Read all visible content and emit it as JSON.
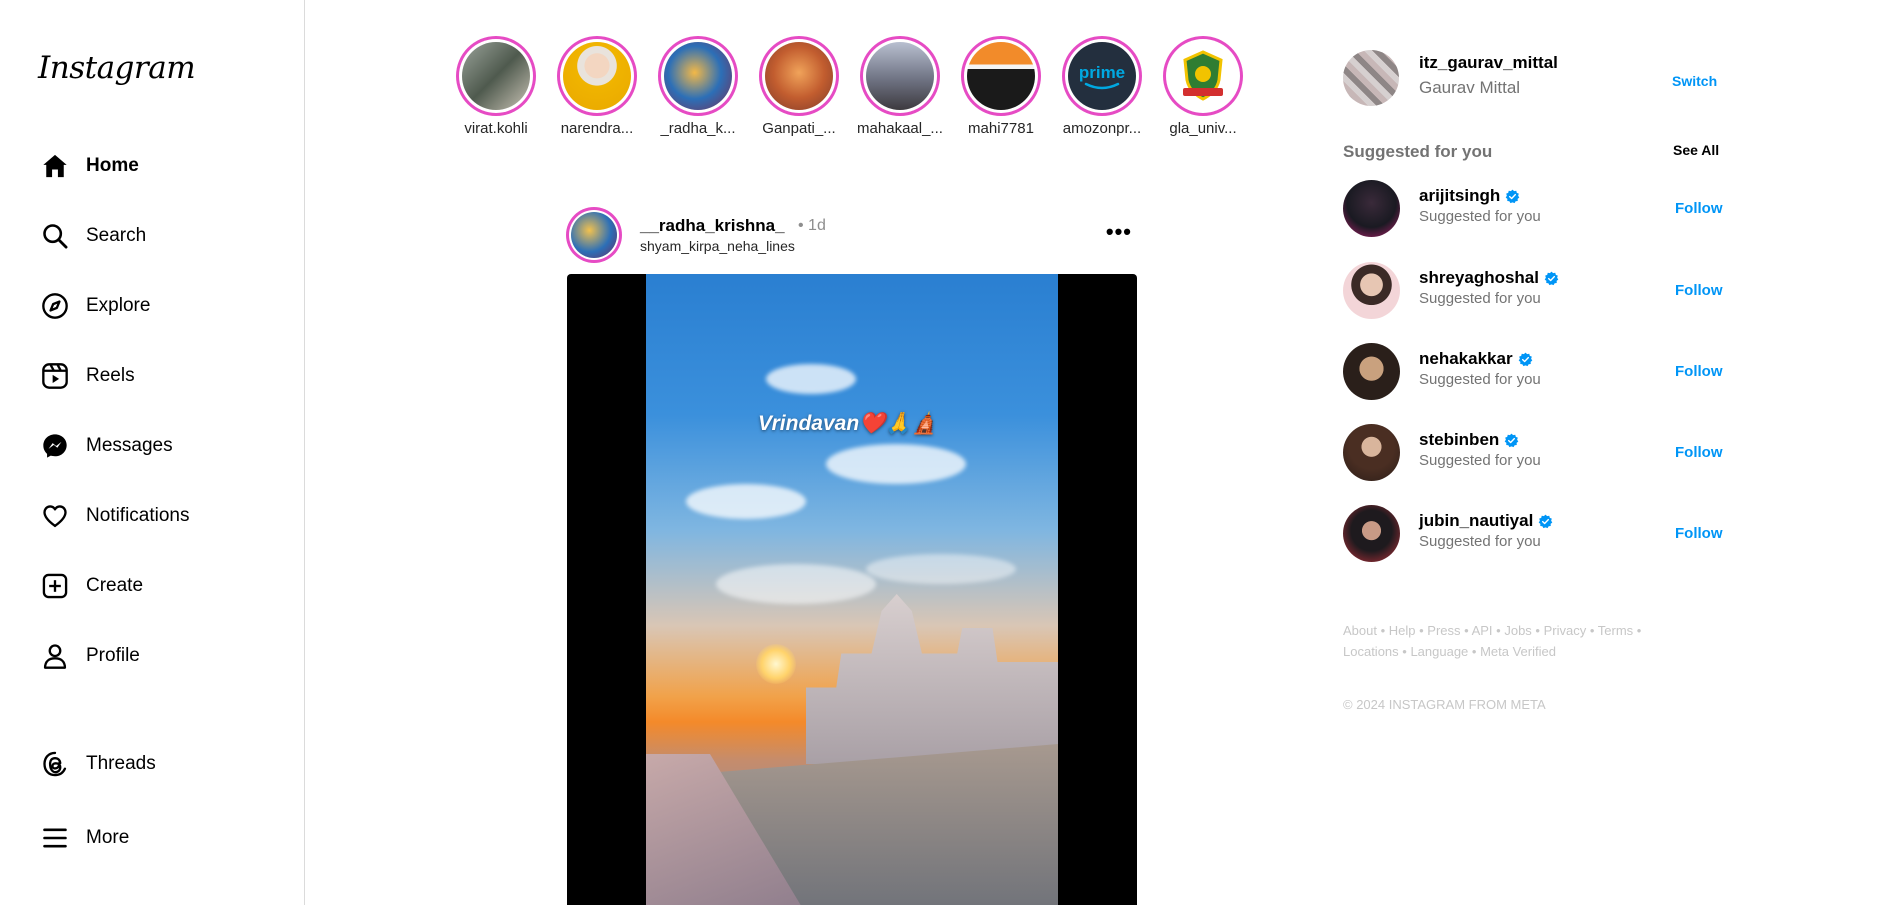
{
  "app": {
    "logo": "Instagram"
  },
  "sidebar": {
    "items": [
      {
        "label": "Home",
        "icon": "home-icon",
        "active": true
      },
      {
        "label": "Search",
        "icon": "search-icon"
      },
      {
        "label": "Explore",
        "icon": "compass-icon"
      },
      {
        "label": "Reels",
        "icon": "reels-icon"
      },
      {
        "label": "Messages",
        "icon": "messenger-icon"
      },
      {
        "label": "Notifications",
        "icon": "heart-icon"
      },
      {
        "label": "Create",
        "icon": "plus-square-icon"
      },
      {
        "label": "Profile",
        "icon": "profile-icon"
      },
      {
        "label": "Threads",
        "icon": "threads-icon"
      },
      {
        "label": "More",
        "icon": "menu-icon"
      }
    ]
  },
  "stories": [
    {
      "username": "virat.kohli"
    },
    {
      "username": "narendra..."
    },
    {
      "username": "_radha_k..."
    },
    {
      "username": "Ganpati_..."
    },
    {
      "username": "mahakaal_..."
    },
    {
      "username": "mahi7781"
    },
    {
      "username": "amozonpr..."
    },
    {
      "username": "gla_univ..."
    }
  ],
  "post": {
    "username": "__radha_krishna_",
    "time": "• 1d",
    "subtitle": "shyam_kirpa_neha_lines",
    "more_label": "•••",
    "video_caption": "Vrindavan❤️🙏🛕"
  },
  "profile": {
    "username": "itz_gaurav_mittal",
    "name": "Gaurav Mittal",
    "switch_label": "Switch"
  },
  "suggestions": {
    "title": "Suggested for you",
    "see_all": "See All",
    "follow_label": "Follow",
    "items": [
      {
        "username": "arijitsingh",
        "subtitle": "Suggested for you",
        "verified": true
      },
      {
        "username": "shreyaghoshal",
        "subtitle": "Suggested for you",
        "verified": true
      },
      {
        "username": "nehakakkar",
        "subtitle": "Suggested for you",
        "verified": true
      },
      {
        "username": "stebinben",
        "subtitle": "Suggested for you",
        "verified": true
      },
      {
        "username": "jubin_nautiyal",
        "subtitle": "Suggested for you",
        "verified": true
      }
    ]
  },
  "footer": {
    "links": [
      "About",
      "Help",
      "Press",
      "API",
      "Jobs",
      "Privacy",
      "Terms",
      "Locations",
      "Language",
      "Meta Verified"
    ],
    "separator": " • ",
    "copyright": "© 2024 INSTAGRAM FROM META"
  },
  "colors": {
    "accent": "#0095f6",
    "story_ring": "#e64bc4",
    "muted_text": "#737373",
    "border": "#dbdbdb"
  }
}
